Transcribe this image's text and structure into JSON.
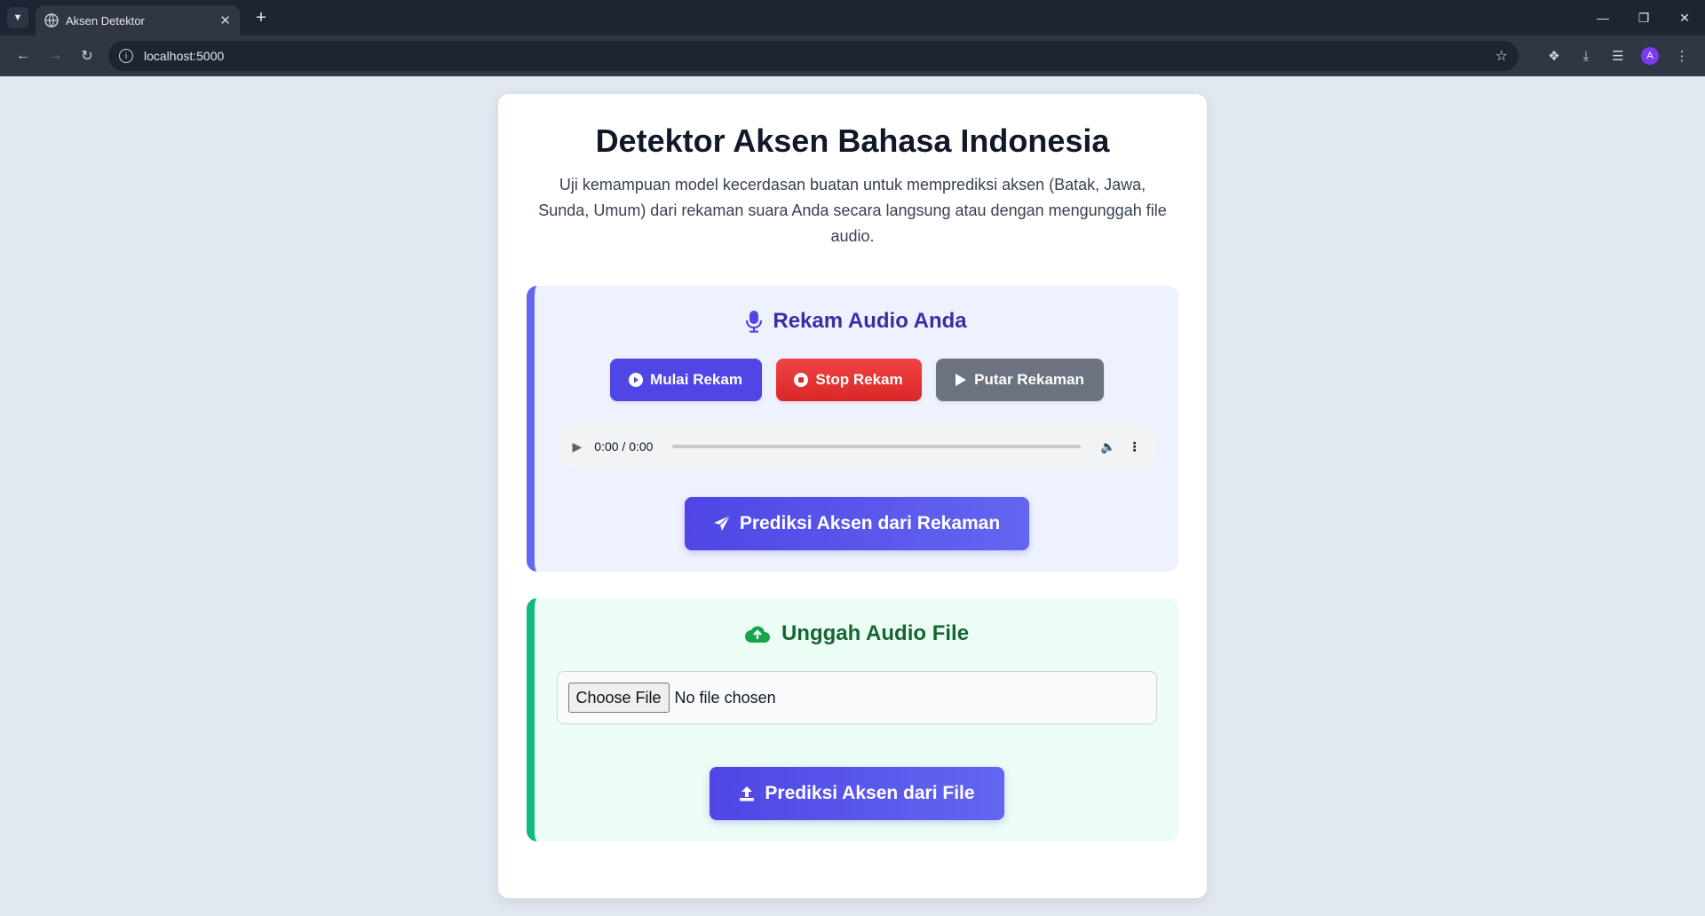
{
  "browser": {
    "tab_title": "Aksen Detektor",
    "url": "localhost:5000",
    "avatar_letter": "A"
  },
  "page": {
    "title": "Detektor Aksen Bahasa Indonesia",
    "description": "Uji kemampuan model kecerdasan buatan untuk memprediksi aksen (Batak, Jawa, Sunda, Umum) dari rekaman suara Anda secara langsung atau dengan mengunggah file audio."
  },
  "record": {
    "title": "Rekam Audio Anda",
    "start_label": "Mulai Rekam",
    "stop_label": "Stop Rekam",
    "play_label": "Putar Rekaman",
    "audio_time": "0:00 / 0:00",
    "predict_label": "Prediksi Aksen dari Rekaman"
  },
  "upload": {
    "title": "Unggah Audio File",
    "choose_label": "Choose File",
    "file_status": "No file chosen",
    "predict_label": "Prediksi Aksen dari File"
  },
  "colors": {
    "primary": "#4f46e5",
    "danger": "#dc2626",
    "neutral": "#6b7280",
    "record_bg": "#eef2ff",
    "upload_bg": "#ecfdf5",
    "upload_accent": "#10b981"
  }
}
